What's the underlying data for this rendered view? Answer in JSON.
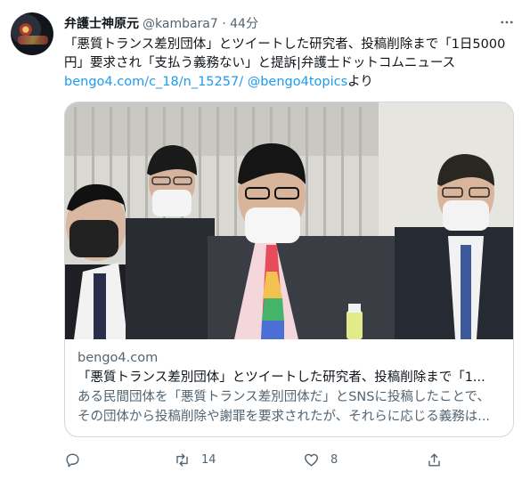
{
  "tweet": {
    "author_name": "弁護士神原元",
    "handle_time": "@kambara7 · 44分",
    "text_line1": "「悪質トランス差別団体」とツイートした研究者、投稿削除まで「1日5000",
    "text_line2": "円」要求され「支払う義務ない」と提訴|弁護士ドットコムニュース",
    "link_url": "bengo4.com/c_18/n_15257/",
    "link_mention": "@bengo4topics",
    "link_suffix": "より",
    "more_icon": "more-horizontal-icon"
  },
  "card": {
    "domain": "bengo4.com",
    "title": "「悪質トランス差別団体」とツイートした研究者、投稿削除まで「1...",
    "desc_line1": "ある民間団体を「悪質トランス差別団体だ」とSNSに投稿したことで、",
    "desc_line2": "その団体から投稿削除や謝罪を要求されたが、それらに応じる義務は..."
  },
  "actions": {
    "reply_icon": "reply-icon",
    "retweet_icon": "retweet-icon",
    "retweet_count": "14",
    "like_icon": "heart-icon",
    "like_count": "8",
    "share_icon": "share-icon"
  },
  "colors": {
    "link": "#1d9bf0",
    "secondary_text": "#536471",
    "border": "#cfd9de"
  }
}
